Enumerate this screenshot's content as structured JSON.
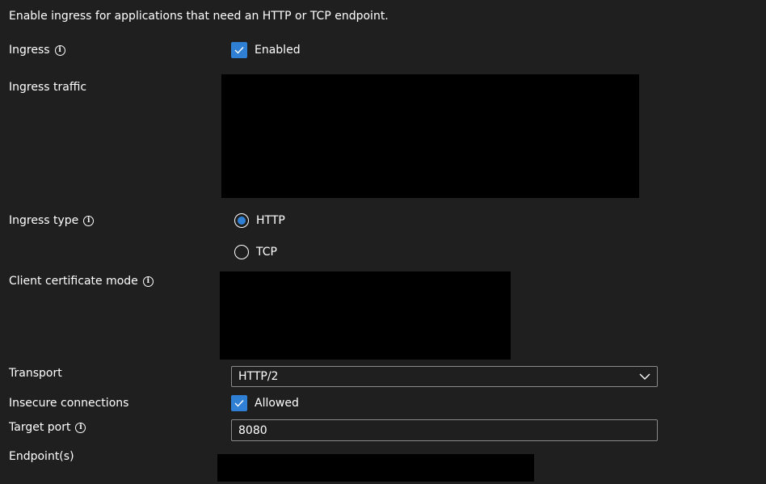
{
  "description": "Enable ingress for applications that need an HTTP or TCP endpoint.",
  "ingress": {
    "label": "Ingress",
    "checkbox_label": "Enabled",
    "checked": true
  },
  "ingress_traffic": {
    "label": "Ingress traffic"
  },
  "ingress_type": {
    "label": "Ingress type",
    "options": [
      {
        "label": "HTTP",
        "selected": true
      },
      {
        "label": "TCP",
        "selected": false
      }
    ]
  },
  "client_certificate_mode": {
    "label": "Client certificate mode"
  },
  "transport": {
    "label": "Transport",
    "selected": "HTTP/2"
  },
  "insecure_connections": {
    "label": "Insecure connections",
    "checkbox_label": "Allowed",
    "checked": true
  },
  "target_port": {
    "label": "Target port",
    "value": "8080"
  },
  "endpoints": {
    "label": "Endpoint(s)"
  },
  "colors": {
    "background": "#1f1f1f",
    "accent": "#2f7fd4",
    "border": "#8a8a8a"
  }
}
